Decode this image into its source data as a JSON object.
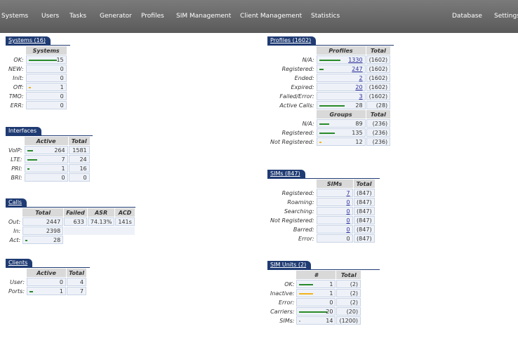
{
  "nav": {
    "items": [
      "Systems",
      "Users",
      "Tasks",
      "Generator",
      "Profiles",
      "SIM Management",
      "Client Management",
      "Statistics"
    ],
    "right": [
      "Database",
      "Settings"
    ]
  },
  "systems": {
    "title": "Systems (16)",
    "header": "Systems",
    "rows": [
      {
        "label": "OK:",
        "value": "15"
      },
      {
        "label": "NEW:",
        "value": "0"
      },
      {
        "label": "Init:",
        "value": "0"
      },
      {
        "label": "Off:",
        "value": "1"
      },
      {
        "label": "TMO:",
        "value": "0"
      },
      {
        "label": "ERR:",
        "value": "0"
      }
    ]
  },
  "interfaces": {
    "title": "Interfaces",
    "headers": [
      "Active",
      "Total"
    ],
    "rows": [
      {
        "label": "VoIP:",
        "active": "264",
        "total": "1581"
      },
      {
        "label": "LTE:",
        "active": "7",
        "total": "24"
      },
      {
        "label": "PRI:",
        "active": "1",
        "total": "16"
      },
      {
        "label": "BRI:",
        "active": "0",
        "total": "0"
      }
    ]
  },
  "calls": {
    "title": "Calls",
    "headers": [
      "Total",
      "Failed",
      "ASR",
      "ACD"
    ],
    "out": {
      "label": "Out:",
      "total": "2447",
      "failed": "633",
      "asr": "74.13%",
      "acd": "141s"
    },
    "in": {
      "label": "In:",
      "total": "2398"
    },
    "act": {
      "label": "Act:",
      "total": "28"
    }
  },
  "clients": {
    "title": "Clients",
    "headers": [
      "Active",
      "Total"
    ],
    "rows": [
      {
        "label": "User:",
        "active": "0",
        "total": "4"
      },
      {
        "label": "Ports:",
        "active": "1",
        "total": "7"
      }
    ]
  },
  "profiles": {
    "title": "Profiles (1602)",
    "headers": [
      "Profiles",
      "Total"
    ],
    "rows": [
      {
        "label": "N/A:",
        "value": "1330",
        "total": "(1602)"
      },
      {
        "label": "Registered:",
        "value": "247",
        "total": "(1602)"
      },
      {
        "label": "Ended:",
        "value": "2",
        "total": "(1602)"
      },
      {
        "label": "Expired:",
        "value": "20",
        "total": "(1602)"
      },
      {
        "label": "Failed/Error:",
        "value": "3",
        "total": "(1602)"
      },
      {
        "label": "Active Calls:",
        "value": "28",
        "total": "(28)"
      }
    ],
    "group_headers": [
      "Groups",
      "Total"
    ],
    "groups": [
      {
        "label": "N/A:",
        "value": "89",
        "total": "(236)"
      },
      {
        "label": "Registered:",
        "value": "135",
        "total": "(236)"
      },
      {
        "label": "Not Registered:",
        "value": "12",
        "total": "(236)"
      }
    ]
  },
  "sims": {
    "title": "SIMs (847)",
    "headers": [
      "SIMs",
      "Total"
    ],
    "rows": [
      {
        "label": "Registered:",
        "value": "7",
        "total": "(847)"
      },
      {
        "label": "Roaming:",
        "value": "0",
        "total": "(847)"
      },
      {
        "label": "Searching:",
        "value": "0",
        "total": "(847)"
      },
      {
        "label": "Not Registered:",
        "value": "0",
        "total": "(847)"
      },
      {
        "label": "Barred:",
        "value": "0",
        "total": "(847)"
      },
      {
        "label": "Error:",
        "value": "0",
        "total": "(847)"
      }
    ]
  },
  "sim_units": {
    "title": "SIM Units (2)",
    "headers": [
      "#",
      "Total"
    ],
    "rows": [
      {
        "label": "OK:",
        "value": "1",
        "total": "(2)"
      },
      {
        "label": "Inactive:",
        "value": "1",
        "total": "(2)"
      },
      {
        "label": "Error:",
        "value": "0",
        "total": "(2)"
      },
      {
        "label": "Carriers:",
        "value": "20",
        "total": "(20)"
      },
      {
        "label": "SIMs:",
        "value": "14",
        "total": "(1200)"
      }
    ]
  },
  "colors": {
    "nav_bg": "#666666",
    "panel_tab": "#1f3b73",
    "ok_bar": "#2a8a2a",
    "warn_bar": "#f2b21a"
  }
}
